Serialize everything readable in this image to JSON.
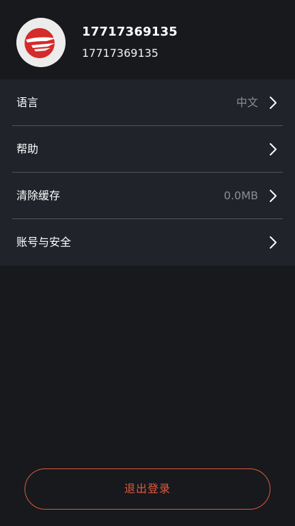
{
  "profile": {
    "name": "17717369135",
    "phone": "17717369135"
  },
  "settings": {
    "items": [
      {
        "label": "语言",
        "value": "中文"
      },
      {
        "label": "帮助",
        "value": ""
      },
      {
        "label": "清除缓存",
        "value": "0.0MB"
      },
      {
        "label": "账号与安全",
        "value": ""
      }
    ]
  },
  "actions": {
    "logout_label": "退出登录"
  },
  "colors": {
    "background": "#18191d",
    "panel": "#21232b",
    "accent": "#e2593c",
    "muted_text": "#8c8e96"
  },
  "icons": {
    "avatar": "red-bird-logo-icon",
    "row_arrow": "chevron-right-icon"
  }
}
